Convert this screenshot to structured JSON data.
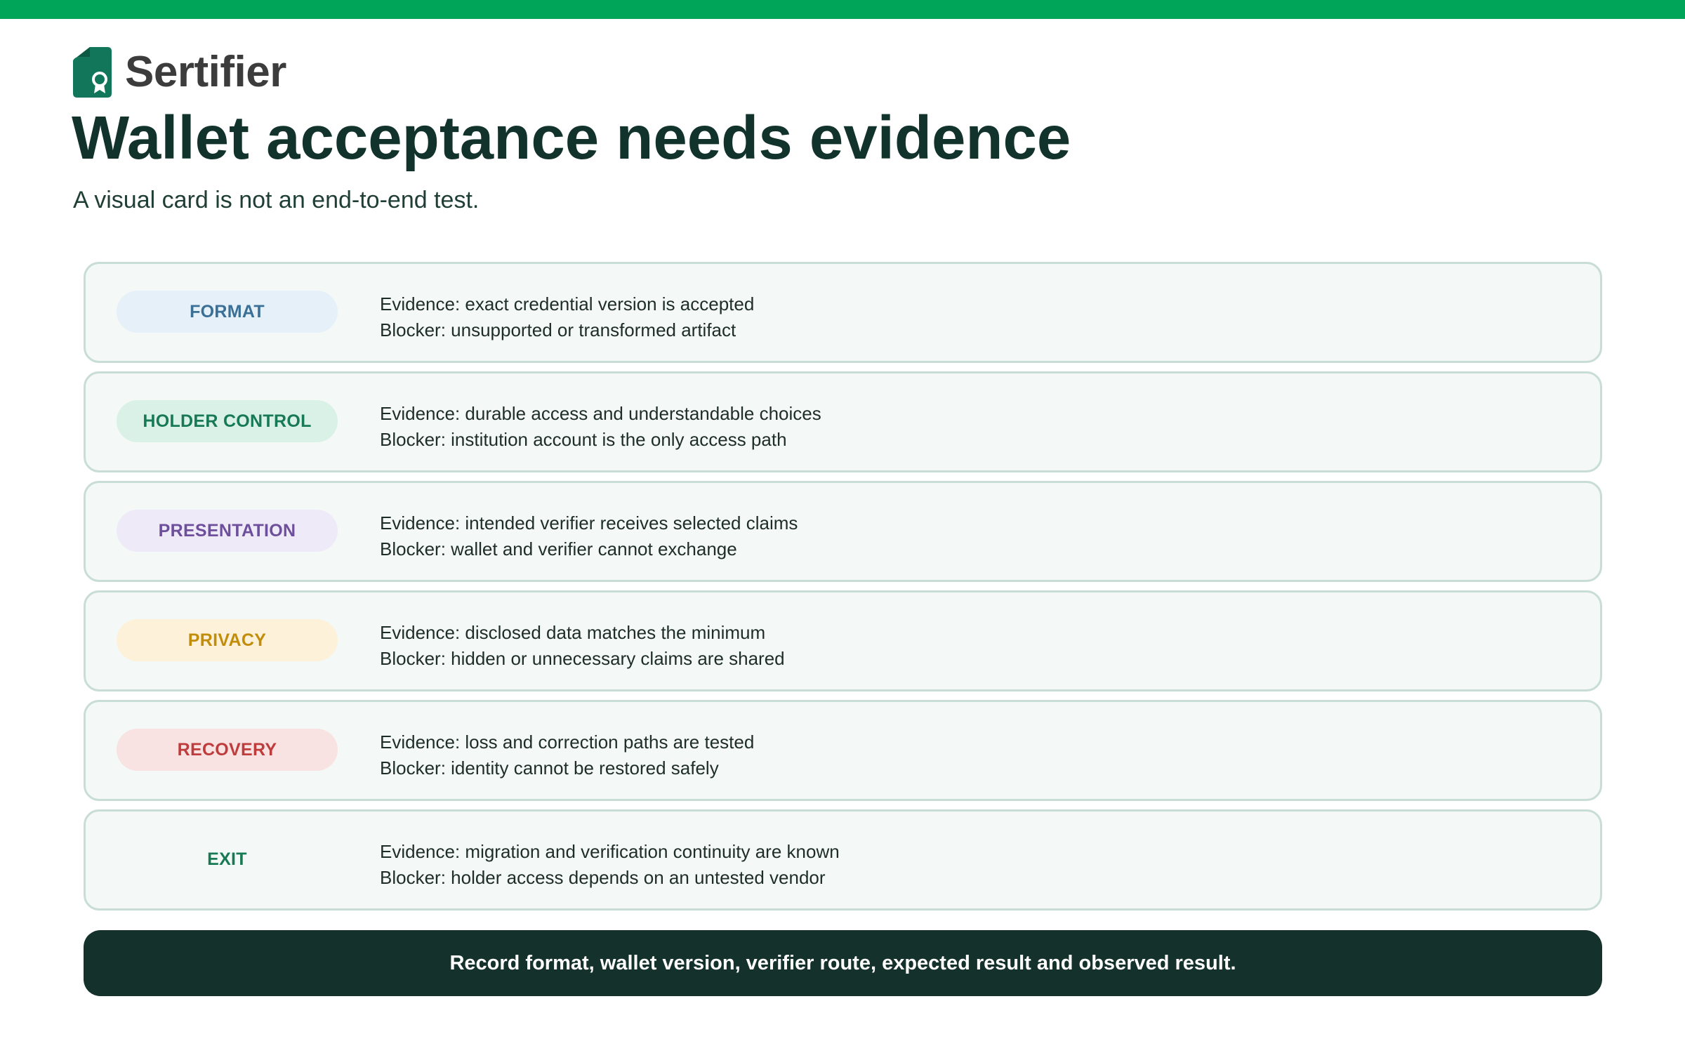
{
  "brand": {
    "name": "Sertifier",
    "logo_icon": "certificate-badge-icon",
    "color": "#12765a"
  },
  "accent_color": "#01a55a",
  "title": "Wallet acceptance needs evidence",
  "subtitle": "A visual card is not an end-to-end test.",
  "rows": [
    {
      "tag": "FORMAT",
      "tag_color": "#3a6f96",
      "tag_bg": "#e6f0f8",
      "evidence": "Evidence: exact credential version is accepted",
      "blocker": "Blocker: unsupported or transformed artifact"
    },
    {
      "tag": "HOLDER CONTROL",
      "tag_color": "#177a55",
      "tag_bg": "#d9f1e6",
      "evidence": "Evidence: durable access and understandable choices",
      "blocker": "Blocker: institution account is the only access path"
    },
    {
      "tag": "PRESENTATION",
      "tag_color": "#6e4f9c",
      "tag_bg": "#eeeaf8",
      "evidence": "Evidence: intended verifier receives selected claims",
      "blocker": "Blocker: wallet and verifier cannot exchange"
    },
    {
      "tag": "PRIVACY",
      "tag_color": "#c38d0c",
      "tag_bg": "#fdf1d9",
      "evidence": "Evidence: disclosed data matches the minimum",
      "blocker": "Blocker: hidden or unnecessary claims are shared"
    },
    {
      "tag": "RECOVERY",
      "tag_color": "#be3c3c",
      "tag_bg": "#f9e2e2",
      "evidence": "Evidence: loss and correction paths are tested",
      "blocker": "Blocker: identity cannot be restored safely"
    },
    {
      "tag": "EXIT",
      "tag_color": "#177a55",
      "tag_bg": "#f4f8f6",
      "evidence": "Evidence: migration and verification continuity are known",
      "blocker": "Blocker: holder access depends on an untested vendor"
    }
  ],
  "footer": "Record format, wallet version, verifier route, expected result and observed result."
}
